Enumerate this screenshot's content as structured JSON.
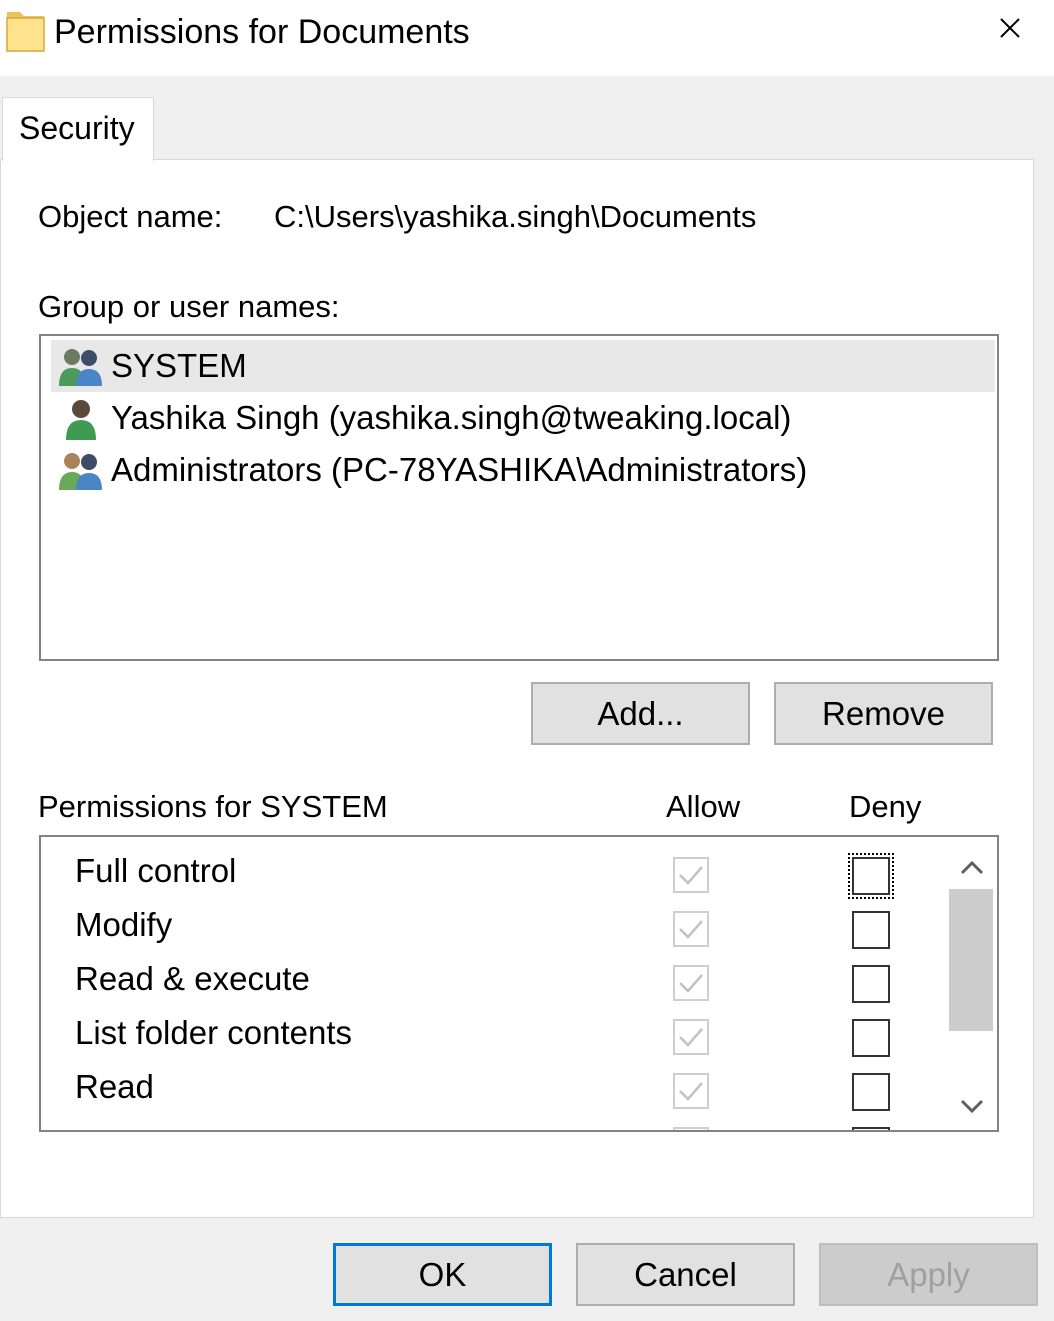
{
  "window": {
    "title": "Permissions for Documents",
    "icon": "folder-icon",
    "close_icon": "close-icon"
  },
  "tabs": [
    {
      "label": "Security",
      "selected": true
    }
  ],
  "object": {
    "label": "Object name:",
    "value": "C:\\Users\\yashika.singh\\Documents"
  },
  "users": {
    "label": "Group or user names:",
    "items": [
      {
        "name": "SYSTEM",
        "icon": "group-users-icon",
        "selected": true
      },
      {
        "name": "Yashika Singh (yashika.singh@tweaking.local)",
        "icon": "user-icon",
        "selected": false
      },
      {
        "name": "Administrators (PC-78YASHIKA\\Administrators)",
        "icon": "group-users-icon",
        "selected": false
      }
    ],
    "add_label": "Add...",
    "remove_label": "Remove"
  },
  "permissions": {
    "label": "Permissions for SYSTEM",
    "allow_header": "Allow",
    "deny_header": "Deny",
    "items": [
      {
        "name": "Full control",
        "allow": true,
        "deny": false
      },
      {
        "name": "Modify",
        "allow": true,
        "deny": false
      },
      {
        "name": "Read & execute",
        "allow": true,
        "deny": false
      },
      {
        "name": "List folder contents",
        "allow": true,
        "deny": false
      },
      {
        "name": "Read",
        "allow": true,
        "deny": false
      }
    ]
  },
  "footer": {
    "ok_label": "OK",
    "cancel_label": "Cancel",
    "apply_label": "Apply"
  },
  "colors": {
    "accent": "#0078d7",
    "selection": "#e8e8e8",
    "window_bg": "#f0f0f0"
  }
}
